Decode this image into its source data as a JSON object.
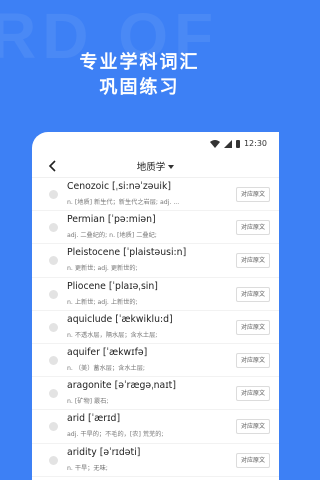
{
  "watermark": "RD OF",
  "hero": {
    "line1": "专业学科词汇",
    "line2": "巩固练习"
  },
  "statusbar": {
    "time": "12:30",
    "icons": [
      "wifi-icon",
      "signal-icon",
      "battery-icon"
    ]
  },
  "navbar": {
    "title": "地质学",
    "back_icon": "chevron-left-icon",
    "dropdown_icon": "caret-down-icon"
  },
  "source_button_label": "对应原文",
  "items": [
    {
      "word": "Cenozoic [ˌsi:nəˈzəuik]",
      "def": "n. [地质] 新生代；新生代之岩层; adj. ..."
    },
    {
      "word": "Permian [ˈpə:miən]",
      "def": "adj. 二叠纪的; n. [地质] 二叠纪;"
    },
    {
      "word": "Pleistocene [ˈplaistəusi:n]",
      "def": "n. 更新世; adj. 更新世的;"
    },
    {
      "word": "Pliocene [ˈplaɪəˌsin]",
      "def": "n. 上新世; adj. 上新世的;"
    },
    {
      "word": "aquiclude [ˈækwiklu:d]",
      "def": "n. 不透水层，隔水层；含水土层;"
    },
    {
      "word": "aquifer [ˈækwɪfə]",
      "def": "n. （美）蓄水层；含水土层;"
    },
    {
      "word": "aragonite [əˈrægəˌnaɪt]",
      "def": "n. [矿物] 霰石;"
    },
    {
      "word": "arid [ˈærɪd]",
      "def": "adj. 干旱的；不毛的，[农] 荒芜的;"
    },
    {
      "word": "aridity [əˈrɪdəti]",
      "def": "n. 干旱；无味;"
    }
  ],
  "colors": {
    "background": "#3d80f5",
    "card": "#ffffff"
  }
}
